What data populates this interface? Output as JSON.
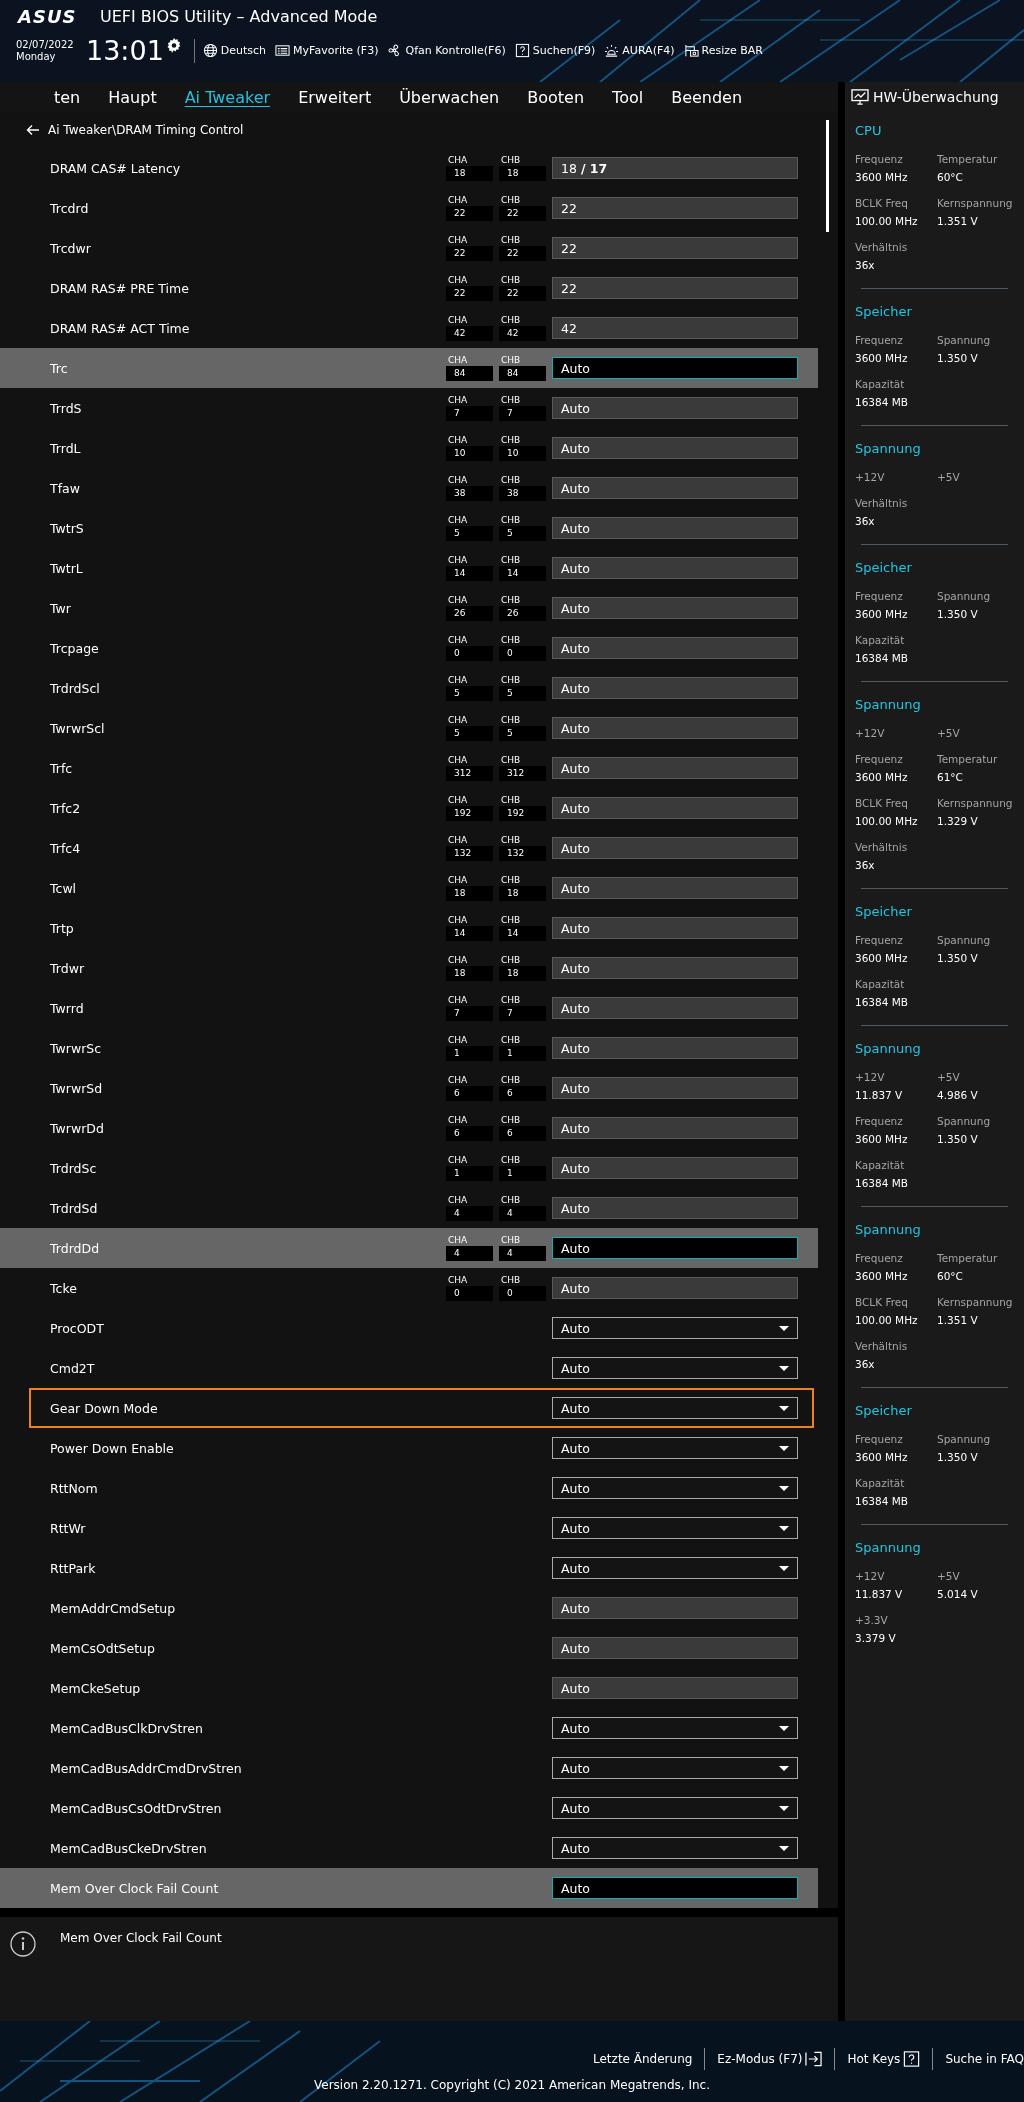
{
  "header": {
    "logo": "ASUS",
    "title": "UEFI BIOS Utility – Advanced Mode",
    "date": "02/07/2022",
    "weekday": "Monday",
    "time": "13:01",
    "tools": [
      {
        "kind": "language",
        "label": "Deutsch"
      },
      {
        "kind": "favorite",
        "label": "MyFavorite (F3)"
      },
      {
        "kind": "fan",
        "label": "Qfan Kontrolle(F6)"
      },
      {
        "kind": "search",
        "label": "Suchen(F9)"
      },
      {
        "kind": "aura",
        "label": "AURA(F4)"
      },
      {
        "kind": "card",
        "label": "Resize BAR"
      }
    ]
  },
  "tabs": [
    {
      "label": "ten",
      "selected": false
    },
    {
      "label": "Haupt",
      "selected": false
    },
    {
      "label": "Ai Tweaker",
      "selected": true
    },
    {
      "label": "Erweitert",
      "selected": false
    },
    {
      "label": "Überwachen",
      "selected": false
    },
    {
      "label": "Booten",
      "selected": false
    },
    {
      "label": "Tool",
      "selected": false
    },
    {
      "label": "Beenden",
      "selected": false
    }
  ],
  "breadcrumb": "Ai Tweaker\\DRAM Timing Control",
  "rows": [
    {
      "name": "DRAM CAS# Latency",
      "channels": [
        {
          "label": "CHA",
          "value": "18"
        },
        {
          "label": "CHB",
          "value": "18"
        }
      ],
      "kind": "field",
      "value": "18  **/ 17**",
      "selected": false,
      "outlined": false
    },
    {
      "name": "Trcdrd",
      "channels": [
        {
          "label": "CHA",
          "value": "22"
        },
        {
          "label": "CHB",
          "value": "22"
        }
      ],
      "kind": "field",
      "value": "22",
      "selected": false,
      "outlined": false
    },
    {
      "name": "Trcdwr",
      "channels": [
        {
          "label": "CHA",
          "value": "22"
        },
        {
          "label": "CHB",
          "value": "22"
        }
      ],
      "kind": "field",
      "value": "22",
      "selected": false,
      "outlined": false
    },
    {
      "name": "DRAM RAS# PRE Time",
      "channels": [
        {
          "label": "CHA",
          "value": "22"
        },
        {
          "label": "CHB",
          "value": "22"
        }
      ],
      "kind": "field",
      "value": "22",
      "selected": false,
      "outlined": false
    },
    {
      "name": "DRAM RAS# ACT Time",
      "channels": [
        {
          "label": "CHA",
          "value": "42"
        },
        {
          "label": "CHB",
          "value": "42"
        }
      ],
      "kind": "field",
      "value": "42",
      "selected": false,
      "outlined": false
    },
    {
      "name": "Trc",
      "channels": [
        {
          "label": "CHA",
          "value": "84"
        },
        {
          "label": "CHB",
          "value": "84"
        }
      ],
      "kind": "field",
      "value": "Auto",
      "selected": true,
      "outlined": false
    },
    {
      "name": "TrrdS",
      "channels": [
        {
          "label": "CHA",
          "value": "7"
        },
        {
          "label": "CHB",
          "value": "7"
        }
      ],
      "kind": "field",
      "value": "Auto",
      "selected": false,
      "outlined": false
    },
    {
      "name": "TrrdL",
      "channels": [
        {
          "label": "CHA",
          "value": "10"
        },
        {
          "label": "CHB",
          "value": "10"
        }
      ],
      "kind": "field",
      "value": "Auto",
      "selected": false,
      "outlined": false
    },
    {
      "name": "Tfaw",
      "channels": [
        {
          "label": "CHA",
          "value": "38"
        },
        {
          "label": "CHB",
          "value": "38"
        }
      ],
      "kind": "field",
      "value": "Auto",
      "selected": false,
      "outlined": false
    },
    {
      "name": "TwtrS",
      "channels": [
        {
          "label": "CHA",
          "value": "5"
        },
        {
          "label": "CHB",
          "value": "5"
        }
      ],
      "kind": "field",
      "value": "Auto",
      "selected": false,
      "outlined": false
    },
    {
      "name": "TwtrL",
      "channels": [
        {
          "label": "CHA",
          "value": "14"
        },
        {
          "label": "CHB",
          "value": "14"
        }
      ],
      "kind": "field",
      "value": "Auto",
      "selected": false,
      "outlined": false
    },
    {
      "name": "Twr",
      "channels": [
        {
          "label": "CHA",
          "value": "26"
        },
        {
          "label": "CHB",
          "value": "26"
        }
      ],
      "kind": "field",
      "value": "Auto",
      "selected": false,
      "outlined": false
    },
    {
      "name": "Trcpage",
      "channels": [
        {
          "label": "CHA",
          "value": "0"
        },
        {
          "label": "CHB",
          "value": "0"
        }
      ],
      "kind": "field",
      "value": "Auto",
      "selected": false,
      "outlined": false
    },
    {
      "name": "TrdrdScl",
      "channels": [
        {
          "label": "CHA",
          "value": "5"
        },
        {
          "label": "CHB",
          "value": "5"
        }
      ],
      "kind": "field",
      "value": "Auto",
      "selected": false,
      "outlined": false
    },
    {
      "name": "TwrwrScl",
      "channels": [
        {
          "label": "CHA",
          "value": "5"
        },
        {
          "label": "CHB",
          "value": "5"
        }
      ],
      "kind": "field",
      "value": "Auto",
      "selected": false,
      "outlined": false
    },
    {
      "name": "Trfc",
      "channels": [
        {
          "label": "CHA",
          "value": "312"
        },
        {
          "label": "CHB",
          "value": "312"
        }
      ],
      "kind": "field",
      "value": "Auto",
      "selected": false,
      "outlined": false
    },
    {
      "name": "Trfc2",
      "channels": [
        {
          "label": "CHA",
          "value": "192"
        },
        {
          "label": "CHB",
          "value": "192"
        }
      ],
      "kind": "field",
      "value": "Auto",
      "selected": false,
      "outlined": false
    },
    {
      "name": "Trfc4",
      "channels": [
        {
          "label": "CHA",
          "value": "132"
        },
        {
          "label": "CHB",
          "value": "132"
        }
      ],
      "kind": "field",
      "value": "Auto",
      "selected": false,
      "outlined": false
    },
    {
      "name": "Tcwl",
      "channels": [
        {
          "label": "CHA",
          "value": "18"
        },
        {
          "label": "CHB",
          "value": "18"
        }
      ],
      "kind": "field",
      "value": "Auto",
      "selected": false,
      "outlined": false
    },
    {
      "name": "Trtp",
      "channels": [
        {
          "label": "CHA",
          "value": "14"
        },
        {
          "label": "CHB",
          "value": "14"
        }
      ],
      "kind": "field",
      "value": "Auto",
      "selected": false,
      "outlined": false
    },
    {
      "name": "Trdwr",
      "channels": [
        {
          "label": "CHA",
          "value": "18"
        },
        {
          "label": "CHB",
          "value": "18"
        }
      ],
      "kind": "field",
      "value": "Auto",
      "selected": false,
      "outlined": false
    },
    {
      "name": "Twrrd",
      "channels": [
        {
          "label": "CHA",
          "value": "7"
        },
        {
          "label": "CHB",
          "value": "7"
        }
      ],
      "kind": "field",
      "value": "Auto",
      "selected": false,
      "outlined": false
    },
    {
      "name": "TwrwrSc",
      "channels": [
        {
          "label": "CHA",
          "value": "1"
        },
        {
          "label": "CHB",
          "value": "1"
        }
      ],
      "kind": "field",
      "value": "Auto",
      "selected": false,
      "outlined": false
    },
    {
      "name": "TwrwrSd",
      "channels": [
        {
          "label": "CHA",
          "value": "6"
        },
        {
          "label": "CHB",
          "value": "6"
        }
      ],
      "kind": "field",
      "value": "Auto",
      "selected": false,
      "outlined": false
    },
    {
      "name": "TwrwrDd",
      "channels": [
        {
          "label": "CHA",
          "value": "6"
        },
        {
          "label": "CHB",
          "value": "6"
        }
      ],
      "kind": "field",
      "value": "Auto",
      "selected": false,
      "outlined": false
    },
    {
      "name": "TrdrdSc",
      "channels": [
        {
          "label": "CHA",
          "value": "1"
        },
        {
          "label": "CHB",
          "value": "1"
        }
      ],
      "kind": "field",
      "value": "Auto",
      "selected": false,
      "outlined": false
    },
    {
      "name": "TrdrdSd",
      "channels": [
        {
          "label": "CHA",
          "value": "4"
        },
        {
          "label": "CHB",
          "value": "4"
        }
      ],
      "kind": "field",
      "value": "Auto",
      "selected": false,
      "outlined": false
    },
    {
      "name": "TrdrdDd",
      "channels": [
        {
          "label": "CHA",
          "value": "4"
        },
        {
          "label": "CHB",
          "value": "4"
        }
      ],
      "kind": "field",
      "value": "Auto",
      "selected": true,
      "outlined": false
    },
    {
      "name": "Tcke",
      "channels": [
        {
          "label": "CHA",
          "value": "0"
        },
        {
          "label": "CHB",
          "value": "0"
        }
      ],
      "kind": "field",
      "value": "Auto",
      "selected": false,
      "outlined": false
    },
    {
      "name": "ProcODT",
      "kind": "dropdown",
      "value": "Auto",
      "selected": false,
      "outlined": false
    },
    {
      "name": "Cmd2T",
      "kind": "dropdown",
      "value": "Auto",
      "selected": false,
      "outlined": false
    },
    {
      "name": "Gear Down Mode",
      "kind": "dropdown",
      "value": "Auto",
      "selected": false,
      "outlined": true
    },
    {
      "name": "Power Down Enable",
      "kind": "dropdown",
      "value": "Auto",
      "selected": false,
      "outlined": false
    },
    {
      "name": "RttNom",
      "kind": "dropdown",
      "value": "Auto",
      "selected": false,
      "outlined": false
    },
    {
      "name": "RttWr",
      "kind": "dropdown",
      "value": "Auto",
      "selected": false,
      "outlined": false
    },
    {
      "name": "RttPark",
      "kind": "dropdown",
      "value": "Auto",
      "selected": false,
      "outlined": false
    },
    {
      "name": "MemAddrCmdSetup",
      "kind": "field",
      "value": "Auto",
      "selected": false,
      "outlined": false
    },
    {
      "name": "MemCsOdtSetup",
      "kind": "field",
      "value": "Auto",
      "selected": false,
      "outlined": false
    },
    {
      "name": "MemCkeSetup",
      "kind": "field",
      "value": "Auto",
      "selected": false,
      "outlined": false
    },
    {
      "name": "MemCadBusClkDrvStren",
      "kind": "dropdown",
      "value": "Auto",
      "selected": false,
      "outlined": false
    },
    {
      "name": "MemCadBusAddrCmdDrvStren",
      "kind": "dropdown",
      "value": "Auto",
      "selected": false,
      "outlined": false
    },
    {
      "name": "MemCadBusCsOdtDrvStren",
      "kind": "dropdown",
      "value": "Auto",
      "selected": false,
      "outlined": false
    },
    {
      "name": "MemCadBusCkeDrvStren",
      "kind": "dropdown",
      "value": "Auto",
      "selected": false,
      "outlined": false
    },
    {
      "name": "Mem Over Clock Fail Count",
      "kind": "field",
      "value": "Auto",
      "selected": true,
      "outlined": false
    }
  ],
  "help": "Mem Over Clock Fail Count",
  "sidebar": {
    "title": "HW-Überwachung",
    "sections": [
      {
        "title": "CPU",
        "items": [
          {
            "label": "Frequenz",
            "value": "3600 MHz"
          },
          {
            "label": "Temperatur",
            "value": "60°C"
          },
          {
            "label": "BCLK Freq",
            "value": "100.00 MHz"
          },
          {
            "label": "Kernspannung",
            "value": "1.351 V"
          },
          {
            "label": "Verhältnis",
            "value": "36x"
          }
        ]
      },
      {
        "title": "Speicher",
        "items": [
          {
            "label": "Frequenz",
            "value": "3600 MHz"
          },
          {
            "label": "Spannung",
            "value": "1.350 V"
          },
          {
            "label": "Kapazität",
            "value": "16384 MB"
          }
        ]
      },
      {
        "title": "Spannung",
        "items": [
          {
            "label": "+12V"
          },
          {
            "label": "+5V"
          },
          {
            "label": "Verhältnis",
            "value": "36x"
          }
        ]
      },
      {
        "title": "Speicher",
        "items": [
          {
            "label": "Frequenz",
            "value": "3600 MHz"
          },
          {
            "label": "Spannung",
            "value": "1.350 V"
          },
          {
            "label": "Kapazität",
            "value": "16384 MB"
          }
        ]
      },
      {
        "title": "Spannung",
        "items": [
          {
            "label": "+12V"
          },
          {
            "label": "+5V"
          },
          {
            "label": "Frequenz",
            "value": "3600 MHz"
          },
          {
            "label": "Temperatur",
            "value": "61°C"
          },
          {
            "label": "BCLK Freq",
            "value": "100.00 MHz"
          },
          {
            "label": "Kernspannung",
            "value": "1.329 V"
          },
          {
            "label": "Verhältnis",
            "value": "36x"
          }
        ]
      },
      {
        "title": "Speicher",
        "items": [
          {
            "label": "Frequenz",
            "value": "3600 MHz"
          },
          {
            "label": "Spannung",
            "value": "1.350 V"
          },
          {
            "label": "Kapazität",
            "value": "16384 MB"
          }
        ]
      },
      {
        "title": "Spannung",
        "items": [
          {
            "label": "+12V",
            "value": "11.837 V"
          },
          {
            "label": "+5V",
            "value": "4.986 V"
          },
          {
            "label": "Frequenz",
            "value": "3600 MHz"
          },
          {
            "label": "Spannung",
            "value": "1.350 V"
          },
          {
            "label": "Kapazität",
            "value": "16384 MB"
          }
        ]
      },
      {
        "title": "Spannung",
        "items": [
          {
            "label": "Frequenz",
            "value": "3600 MHz"
          },
          {
            "label": "Temperatur",
            "value": "60°C"
          },
          {
            "label": "BCLK Freq",
            "value": "100.00 MHz"
          },
          {
            "label": "Kernspannung",
            "value": "1.351 V"
          },
          {
            "label": "Verhältnis",
            "value": "36x"
          }
        ]
      },
      {
        "title": "Speicher",
        "items": [
          {
            "label": "Frequenz",
            "value": "3600 MHz"
          },
          {
            "label": "Spannung",
            "value": "1.350 V"
          },
          {
            "label": "Kapazität",
            "value": "16384 MB"
          }
        ]
      },
      {
        "title": "Spannung",
        "items": [
          {
            "label": "+12V",
            "value": "11.837 V"
          },
          {
            "label": "+5V",
            "value": "5.014 V"
          },
          {
            "label": "+3.3V",
            "value": "3.379 V"
          }
        ]
      }
    ]
  },
  "footer": {
    "links": [
      {
        "kind": "text",
        "label": "Letzte Änderung"
      },
      {
        "kind": "exit",
        "label": "Ez-Modus (F7)"
      },
      {
        "kind": "help",
        "label": "Hot Keys"
      },
      {
        "kind": "text",
        "label": "Suche in FAQ"
      }
    ],
    "version": "Version 2.20.1271. Copyright (C) 2021 American Megatrends, Inc."
  }
}
